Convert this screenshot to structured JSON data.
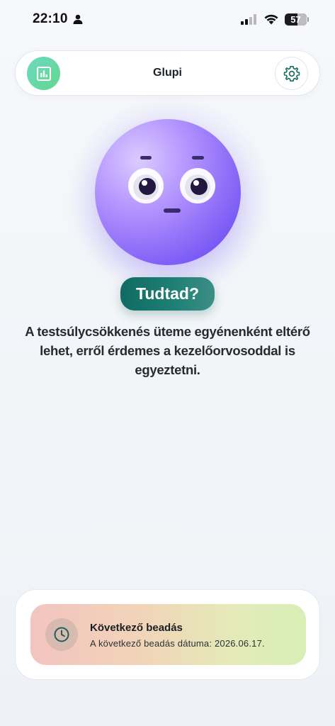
{
  "status_bar": {
    "time": "22:10",
    "battery_level": "57",
    "battery_fraction": 0.57,
    "icons": [
      "person-icon",
      "signal-icon",
      "wifi-icon",
      "battery-icon"
    ]
  },
  "header": {
    "title": "Glupi",
    "left_icon": "bar-chart-icon",
    "right_icon": "gear-icon"
  },
  "mascot": {
    "description_icon": "mascot-face"
  },
  "fact": {
    "badge": "Tudtad?",
    "text": "A testsúlycsökkenés üteme egyénenként eltérő lehet, erről érdemes a kezelőorvosoddal is egyeztetni."
  },
  "next_submission": {
    "title": "Következő beadás",
    "subtitle": "A következő beadás dátuma: 2026.06.17.",
    "icon": "clock-icon"
  },
  "colors": {
    "accent_teal": "#0f6b63",
    "mascot_purple": "#8f6ef8",
    "stats_green": "#61d989"
  }
}
